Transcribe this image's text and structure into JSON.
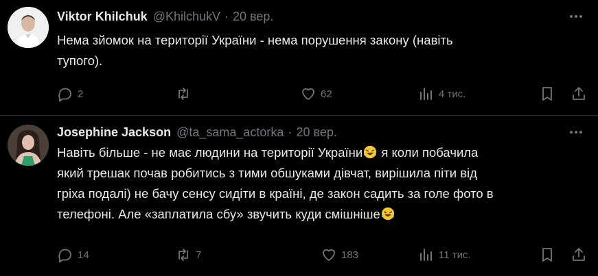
{
  "tweets": [
    {
      "name": "Viktor Khilchuk",
      "handle": "@KhilchukV",
      "separator": "·",
      "time": "20 вер.",
      "text_line1": "Нема зйомок на території України - нема порушення закону (навіть",
      "text_line2": "тупого).",
      "replies": "2",
      "reposts": "",
      "likes": "62",
      "views": "4 тис."
    },
    {
      "name": "Josephine Jackson",
      "handle": "@ta_sama_actorka",
      "separator": "·",
      "time": "20 вер.",
      "text_line1": "Навіть більше - не має людини на території України",
      "text_line1b": " я коли побачила",
      "text_line2": "який трешак почав робитись з тими обшуками дівчат, вирішила піти від",
      "text_line3": "гріха подалі) не бачу сенсу сидіти в країні, де закон садить за голе фото в",
      "text_line4": "телефоні. Але «заплатила сбу» звучить куди смішніше",
      "replies": "14",
      "reposts": "7",
      "likes": "183",
      "views": "11 тис."
    }
  ],
  "icons": {
    "reply": "reply-icon",
    "repost": "repost-icon",
    "like": "heart-icon",
    "views": "views-chart-icon",
    "bookmark": "bookmark-icon",
    "share": "share-icon",
    "more": "more-dots-icon",
    "emoji": "laughing-tears-emoji"
  },
  "colors": {
    "background": "#000000",
    "text": "#e7e9ea",
    "muted": "#71767b",
    "divider": "#2f3336"
  }
}
